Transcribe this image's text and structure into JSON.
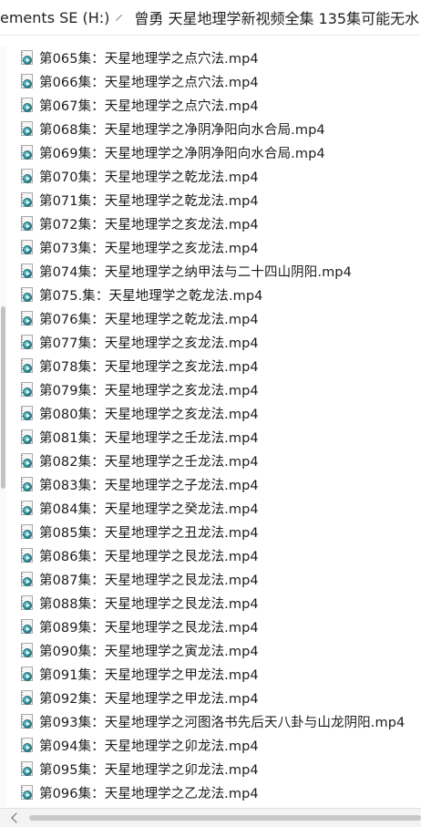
{
  "breadcrumb": {
    "drive": "ements SE (H:)",
    "folder": "曾勇 天星地理学新视频全集 135集可能无水"
  },
  "files": [
    "第065集：天星地理学之点穴法.mp4",
    "第066集：天星地理学之点穴法.mp4",
    "第067集：天星地理学之点穴法.mp4",
    "第068集：天星地理学之净阴净阳向水合局.mp4",
    "第069集：天星地理学之净阴净阳向水合局.mp4",
    "第070集：天星地理学之乾龙法.mp4",
    "第071集：天星地理学之乾龙法.mp4",
    "第072集：天星地理学之亥龙法.mp4",
    "第073集：天星地理学之亥龙法.mp4",
    "第074集：天星地理学之纳甲法与二十四山阴阳.mp4",
    "第075.集：天星地理学之乾龙法.mp4",
    "第076集：天星地理学之乾龙法.mp4",
    "第077集：天星地理学之亥龙法.mp4",
    "第078集：天星地理学之亥龙法.mp4",
    "第079集：天星地理学之亥龙法.mp4",
    "第080集：天星地理学之亥龙法.mp4",
    "第081集：天星地理学之壬龙法.mp4",
    "第082集：天星地理学之壬龙法.mp4",
    "第083集：天星地理学之子龙法.mp4",
    "第084集：天星地理学之癸龙法.mp4",
    "第085集：天星地理学之丑龙法.mp4",
    "第086集：天星地理学之艮龙法.mp4",
    "第087集：天星地理学之艮龙法.mp4",
    "第088集：天星地理学之艮龙法.mp4",
    "第089集：天星地理学之艮龙法.mp4",
    "第090集：天星地理学之寅龙法.mp4",
    "第091集：天星地理学之甲龙法.mp4",
    "第092集：天星地理学之甲龙法.mp4",
    "第093集：天星地理学之河图洛书先后天八卦与山龙阴阳.mp4",
    "第094集：天星地理学之卯龙法.mp4",
    "第095集：天星地理学之卯龙法.mp4",
    "第096集：天星地理学之乙龙法.mp4"
  ],
  "icon": "video-file-icon",
  "colors": {
    "badge": "#2a8d98",
    "text": "#1c1c1c",
    "scrollbar": "#c3c3c3"
  },
  "scroll": {
    "vertical_position": 0.45,
    "visible_fraction": 0.24
  }
}
